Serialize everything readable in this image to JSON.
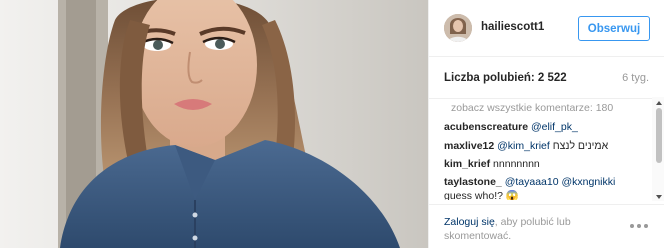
{
  "post": {
    "photo_alt": "",
    "username": "hailiescott1",
    "follow_label": "Obserwuj",
    "likes_text": "Liczba polubień: 2 522",
    "age": "6 tyg."
  },
  "comments": {
    "view_all": "zobacz wszystkie komentarze: 180",
    "items": [
      {
        "user": "acubenscreature",
        "text": "@elif_pk_"
      },
      {
        "user": "maxlive12",
        "mention": "@kim_krief",
        "text": "אמינים לנצח"
      },
      {
        "user": "kim_krief",
        "text": "nnnnnnnn"
      },
      {
        "user": "taylastone_",
        "text": "@tayaaa10 @kxngnikki",
        "line2": "guess who!? 😱"
      }
    ]
  },
  "footer": {
    "login_link": "Zaloguj się",
    "login_rest": ", aby polubić lub skomentować."
  },
  "icons": {
    "more": "more-options-icon",
    "scroll_up": "scroll-up-arrow-icon",
    "scroll_down": "scroll-down-arrow-icon"
  },
  "colors": {
    "accent": "#3897f0",
    "link": "#003569",
    "muted": "#999999",
    "text": "#262626"
  }
}
